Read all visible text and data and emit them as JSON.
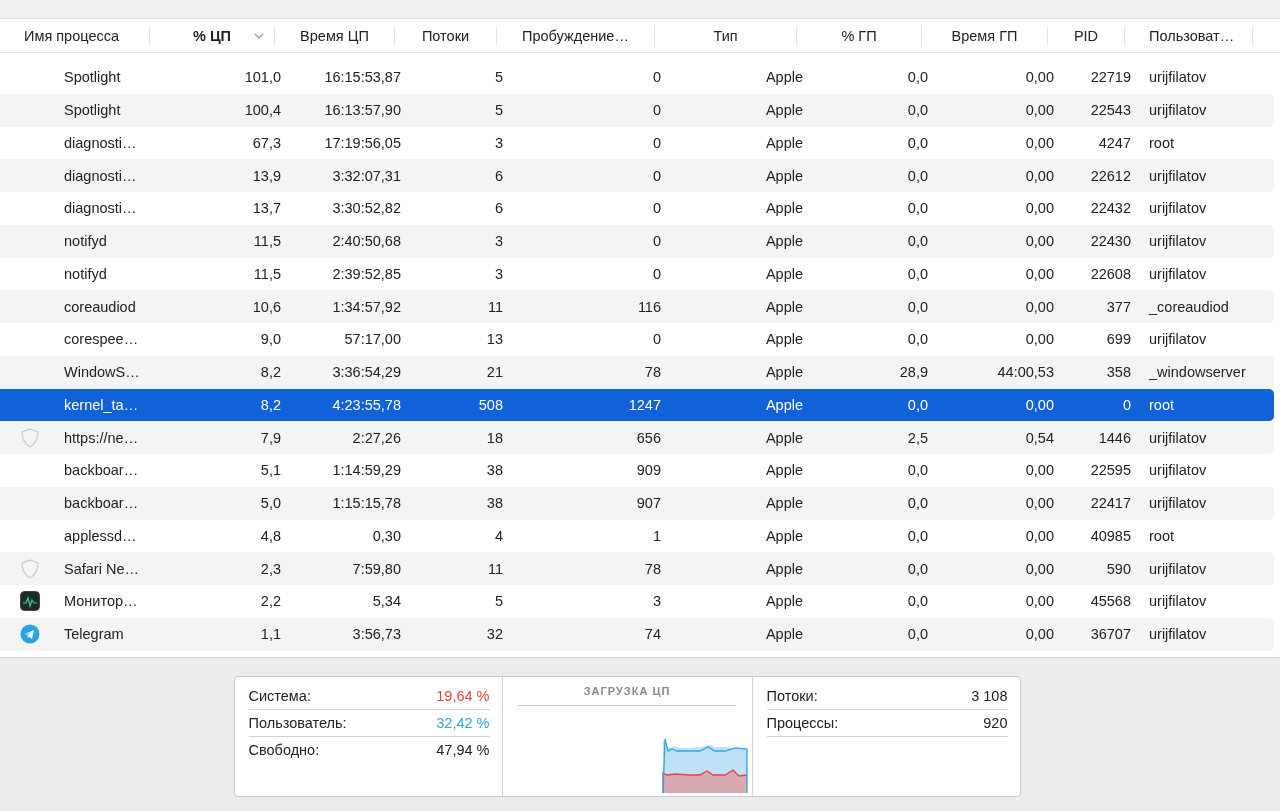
{
  "table": {
    "columns": [
      {
        "label": "Имя процесса",
        "selected": false
      },
      {
        "label": "% ЦП",
        "selected": true
      },
      {
        "label": "Время ЦП",
        "selected": false
      },
      {
        "label": "Потоки",
        "selected": false
      },
      {
        "label": "Пробуждение…",
        "selected": false
      },
      {
        "label": "Тип",
        "selected": false
      },
      {
        "label": "% ГП",
        "selected": false
      },
      {
        "label": "Время ГП",
        "selected": false
      },
      {
        "label": "PID",
        "selected": false
      },
      {
        "label": "Пользоват…",
        "selected": false
      }
    ],
    "rows": [
      {
        "kind": "plain",
        "cells": [
          "Spotlight",
          "101,0",
          "16:15:53,87",
          "5",
          "0",
          "Apple",
          "0,0",
          "0,00",
          "22719",
          "urijfilatov"
        ],
        "selected": false
      },
      {
        "kind": "plain",
        "cells": [
          "Spotlight",
          "100,4",
          "16:13:57,90",
          "5",
          "0",
          "Apple",
          "0,0",
          "0,00",
          "22543",
          "urijfilatov"
        ],
        "selected": false
      },
      {
        "kind": "plain",
        "cells": [
          "diagnosti…",
          "67,3",
          "17:19:56,05",
          "3",
          "0",
          "Apple",
          "0,0",
          "0,00",
          "4247",
          "root"
        ],
        "selected": false
      },
      {
        "kind": "plain",
        "cells": [
          "diagnosti…",
          "13,9",
          "3:32:07,31",
          "6",
          "0",
          "Apple",
          "0,0",
          "0,00",
          "22612",
          "urijfilatov"
        ],
        "selected": false
      },
      {
        "kind": "plain",
        "cells": [
          "diagnosti…",
          "13,7",
          "3:30:52,82",
          "6",
          "0",
          "Apple",
          "0,0",
          "0,00",
          "22432",
          "urijfilatov"
        ],
        "selected": false
      },
      {
        "kind": "plain",
        "cells": [
          "notifyd",
          "11,5",
          "2:40:50,68",
          "3",
          "0",
          "Apple",
          "0,0",
          "0,00",
          "22430",
          "urijfilatov"
        ],
        "selected": false
      },
      {
        "kind": "plain",
        "cells": [
          "notifyd",
          "11,5",
          "2:39:52,85",
          "3",
          "0",
          "Apple",
          "0,0",
          "0,00",
          "22608",
          "urijfilatov"
        ],
        "selected": false
      },
      {
        "kind": "plain",
        "cells": [
          "coreaudiod",
          "10,6",
          "1:34:57,92",
          "11",
          "116",
          "Apple",
          "0,0",
          "0,00",
          "377",
          "_coreaudiod"
        ],
        "selected": false
      },
      {
        "kind": "plain",
        "cells": [
          "corespee…",
          "9,0",
          "57:17,00",
          "13",
          "0",
          "Apple",
          "0,0",
          "0,00",
          "699",
          "urijfilatov"
        ],
        "selected": false
      },
      {
        "kind": "plain",
        "cells": [
          "WindowS…",
          "8,2",
          "3:36:54,29",
          "21",
          "78",
          "Apple",
          "28,9",
          "44:00,53",
          "358",
          "_windowserver"
        ],
        "selected": false
      },
      {
        "kind": "plain",
        "cells": [
          "kernel_ta…",
          "8,2",
          "4:23:55,78",
          "508",
          "1247",
          "Apple",
          "0,0",
          "0,00",
          "0",
          "root"
        ],
        "selected": true
      },
      {
        "kind": "shield",
        "cells": [
          "https://ne…",
          "7,9",
          "2:27,26",
          "18",
          "656",
          "Apple",
          "2,5",
          "0,54",
          "1446",
          "urijfilatov"
        ],
        "selected": false
      },
      {
        "kind": "plain",
        "cells": [
          "backboar…",
          "5,1",
          "1:14:59,29",
          "38",
          "909",
          "Apple",
          "0,0",
          "0,00",
          "22595",
          "urijfilatov"
        ],
        "selected": false
      },
      {
        "kind": "plain",
        "cells": [
          "backboar…",
          "5,0",
          "1:15:15,78",
          "38",
          "907",
          "Apple",
          "0,0",
          "0,00",
          "22417",
          "urijfilatov"
        ],
        "selected": false
      },
      {
        "kind": "plain",
        "cells": [
          "applessd…",
          "4,8",
          "0,30",
          "4",
          "1",
          "Apple",
          "0,0",
          "0,00",
          "40985",
          "root"
        ],
        "selected": false
      },
      {
        "kind": "shield",
        "cells": [
          "Safari Ne…",
          "2,3",
          "7:59,80",
          "11",
          "78",
          "Apple",
          "0,0",
          "0,00",
          "590",
          "urijfilatov"
        ],
        "selected": false
      },
      {
        "kind": "monitor",
        "cells": [
          "Монитор…",
          "2,2",
          "5,34",
          "5",
          "3",
          "Apple",
          "0,0",
          "0,00",
          "45568",
          "urijfilatov"
        ],
        "selected": false
      },
      {
        "kind": "telegram",
        "cells": [
          "Telegram",
          "1,1",
          "3:56,73",
          "32",
          "74",
          "Apple",
          "0,0",
          "0,00",
          "36707",
          "urijfilatov"
        ],
        "selected": false
      }
    ]
  },
  "summary": {
    "left": [
      {
        "label": "Система:",
        "value": "19,64 %",
        "color": "#e8433a"
      },
      {
        "label": "Пользователь:",
        "value": "32,42 %",
        "color": "#2ea7e0"
      },
      {
        "label": "Свободно:",
        "value": "47,94 %",
        "color": "#222222"
      }
    ],
    "chart_title": "ЗАГРУЗКА ЦП",
    "right": [
      {
        "label": "Потоки:",
        "value": "3 108"
      },
      {
        "label": "Процессы:",
        "value": "920"
      }
    ]
  }
}
